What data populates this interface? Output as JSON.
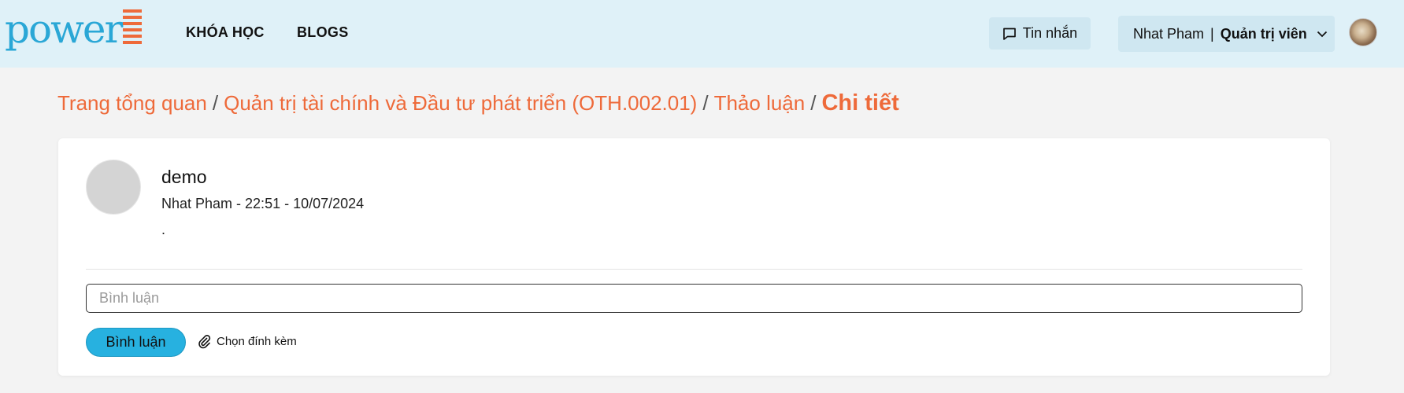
{
  "header": {
    "logo_text": "power",
    "brand_color": "#2aa7d6",
    "accent_color": "#ee6a3a",
    "nav": [
      {
        "label": "KHÓA HỌC"
      },
      {
        "label": "BLOGS"
      }
    ],
    "messages_label": "Tin nhắn",
    "messages_icon": "chat-icon",
    "user_name": "Nhat Pham",
    "user_separator": "|",
    "user_role": "Quản trị viên",
    "user_menu_icon": "chevron-down-icon"
  },
  "breadcrumb": {
    "items": [
      "Trang tổng quan",
      "Quản trị tài chính và Đầu tư phát triển (OTH.002.01)",
      "Thảo luận"
    ],
    "separator": "/",
    "current": "Chi tiết"
  },
  "post": {
    "title": "demo",
    "meta": "Nhat Pham - 22:51 - 10/07/2024",
    "body": "."
  },
  "comment": {
    "input_placeholder": "Bình luận",
    "input_value": "",
    "submit_label": "Bình luận",
    "attach_label": "Chọn đính kèm",
    "attach_icon": "paperclip-icon"
  }
}
